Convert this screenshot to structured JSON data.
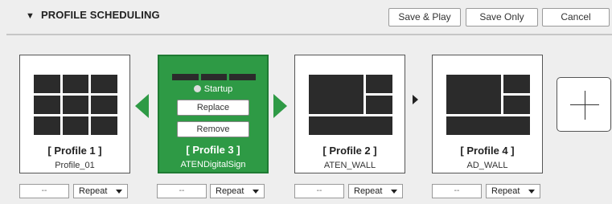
{
  "section": {
    "title": "PROFILE SCHEDULING",
    "toggle_glyph": "▼"
  },
  "toolbar": {
    "save_play_label": "Save & Play",
    "save_only_label": "Save Only",
    "cancel_label": "Cancel"
  },
  "profiles": [
    {
      "name": "[ Profile 1 ]",
      "subtitle": "Profile_01",
      "duration": "--",
      "repeat": "Repeat"
    },
    {
      "name": "[ Profile 3 ]",
      "subtitle": "ATENDigitalSign",
      "duration": "--",
      "repeat": "Repeat",
      "startup_label": "Startup",
      "replace_label": "Replace",
      "remove_label": "Remove"
    },
    {
      "name": "[ Profile 2 ]",
      "subtitle": "ATEN_WALL",
      "duration": "--",
      "repeat": "Repeat"
    },
    {
      "name": "[ Profile 4 ]",
      "subtitle": "AD_WALL",
      "duration": "--",
      "repeat": "Repeat"
    }
  ],
  "icons": {
    "add": "plus-icon",
    "move_left": "green-left-arrow-icon",
    "move_right": "green-right-arrow-icon",
    "sequence": "sequence-arrow-icon"
  },
  "colors": {
    "selected_card": "#2e9a45",
    "background": "#eeeeee",
    "layout_cells": "#2b2b2b"
  }
}
